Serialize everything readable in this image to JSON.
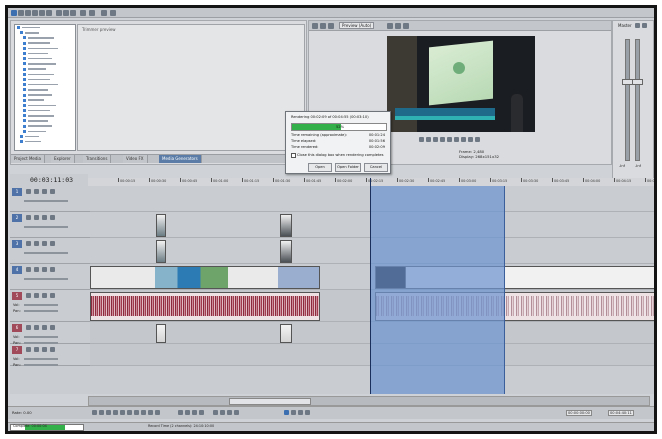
{
  "app": {
    "name": "Video editor (Vegas-style)"
  },
  "explorer": {
    "preview_label": "Trimmer preview",
    "tabs": [
      "Project Media",
      "Explorer",
      "Transitions",
      "Video FX",
      "Media Generators"
    ],
    "active_tab_index": 4
  },
  "preview": {
    "toolbar_label": "Preview (Auto)",
    "frame_label": "Frame:",
    "frame_value": "2,480",
    "display_label": "Display:",
    "display_value": "268x151x32"
  },
  "render_dialog": {
    "title": "Rendering 00:02:09 of 00:04:55 (00:03:10)",
    "progress_percent": 52,
    "progress_text": "52%",
    "rows": [
      {
        "label": "Time remaining (approximate):",
        "value": "00:01:24"
      },
      {
        "label": "Time elapsed:",
        "value": "00:01:56"
      },
      {
        "label": "Time rendered:",
        "value": "00:02:09"
      }
    ],
    "checkbox_label": "Close this dialog box when rendering completes",
    "buttons": [
      "Open",
      "Open Folder",
      "Cancel"
    ]
  },
  "timeline": {
    "timecode": "00:03:11:03",
    "ruler_labels": [
      "00:00:15",
      "00:00:30",
      "00:00:45",
      "00:01:00",
      "00:01:15",
      "00:01:30",
      "00:01:45",
      "00:02:00",
      "00:02:15",
      "00:02:30",
      "00:02:45",
      "00:03:00",
      "00:03:15",
      "00:03:30",
      "00:03:45",
      "00:04:00",
      "00:04:15",
      "00:04:30"
    ],
    "tracks": [
      {
        "type": "video",
        "number": "1"
      },
      {
        "type": "video",
        "number": "2"
      },
      {
        "type": "video",
        "number": "3"
      },
      {
        "type": "video",
        "number": "4"
      },
      {
        "type": "audio",
        "number": "5",
        "vol_label": "Vol:",
        "pan_label": "Pan:"
      },
      {
        "type": "audio",
        "number": "6",
        "vol_label": "Vol:",
        "pan_label": "Pan:"
      },
      {
        "type": "audio",
        "number": "7",
        "vol_label": "Vol:",
        "pan_label": "Pan:"
      }
    ]
  },
  "transport": {
    "rate_label": "Rate: 0.00",
    "time_left": "00:00:00:00",
    "time_right": "00:04:40:11"
  },
  "master": {
    "label": "Master",
    "db_values": [
      "-Inf",
      "-Inf"
    ]
  },
  "statusbar": {
    "left": "Complete: 00:00:04",
    "center": "Record Time (2 channels): 24:10:10:00"
  },
  "colors": {
    "selection": "#8aa6d4",
    "waveform": "#8a2a3c",
    "progress": "#34b04a",
    "tab_active": "#5a7ca6"
  }
}
